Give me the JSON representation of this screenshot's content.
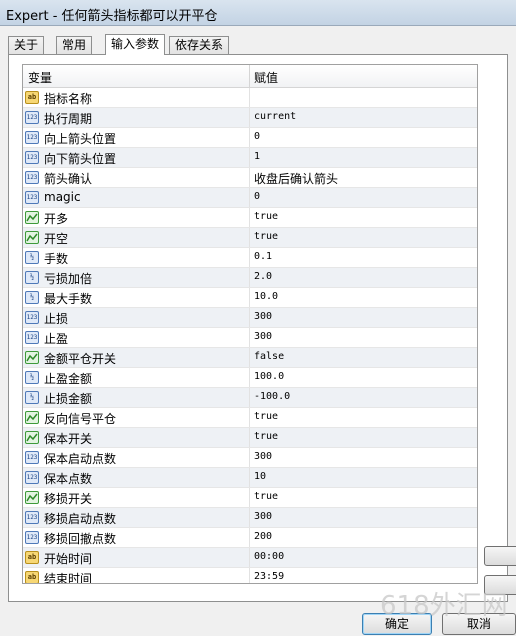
{
  "window": {
    "title": "Expert - 任何箭头指标都可以开平仓"
  },
  "tabs": [
    {
      "label": "关于",
      "active": false
    },
    {
      "label": "常用",
      "active": false
    },
    {
      "label": "输入参数",
      "active": true
    },
    {
      "label": "依存关系",
      "active": false
    }
  ],
  "grid": {
    "header": {
      "variable": "变量",
      "value": "赋值"
    },
    "rows": [
      {
        "icon": "ab-string-icon",
        "name": "指标名称",
        "value": ""
      },
      {
        "icon": "123-integer-icon",
        "name": "执行周期",
        "value": "current"
      },
      {
        "icon": "123-integer-icon",
        "name": "向上箭头位置",
        "value": "0"
      },
      {
        "icon": "123-integer-icon",
        "name": "向下箭头位置",
        "value": "1"
      },
      {
        "icon": "123-integer-icon",
        "name": "箭头确认",
        "value": "收盘后确认箭头"
      },
      {
        "icon": "123-integer-icon",
        "name": "magic",
        "value": "0"
      },
      {
        "icon": "bool-chart-icon",
        "name": "开多",
        "value": "true"
      },
      {
        "icon": "bool-chart-icon",
        "name": "开空",
        "value": "true"
      },
      {
        "icon": "double-icon",
        "name": "手数",
        "value": "0.1"
      },
      {
        "icon": "double-icon",
        "name": "亏损加倍",
        "value": "2.0"
      },
      {
        "icon": "double-icon",
        "name": "最大手数",
        "value": "10.0"
      },
      {
        "icon": "123-integer-icon",
        "name": "止损",
        "value": "300"
      },
      {
        "icon": "123-integer-icon",
        "name": "止盈",
        "value": "300"
      },
      {
        "icon": "bool-chart-icon",
        "name": "金额平仓开关",
        "value": "false"
      },
      {
        "icon": "double-icon",
        "name": "止盈金额",
        "value": "100.0"
      },
      {
        "icon": "double-icon",
        "name": "止损金额",
        "value": "-100.0"
      },
      {
        "icon": "bool-chart-icon",
        "name": "反向信号平仓",
        "value": "true"
      },
      {
        "icon": "bool-chart-icon",
        "name": "保本开关",
        "value": "true"
      },
      {
        "icon": "123-integer-icon",
        "name": "保本启动点数",
        "value": "300"
      },
      {
        "icon": "123-integer-icon",
        "name": "保本点数",
        "value": "10"
      },
      {
        "icon": "bool-chart-icon",
        "name": "移损开关",
        "value": "true"
      },
      {
        "icon": "123-integer-icon",
        "name": "移损启动点数",
        "value": "300"
      },
      {
        "icon": "123-integer-icon",
        "name": "移损回撤点数",
        "value": "200"
      },
      {
        "icon": "ab-string-icon",
        "name": "开始时间",
        "value": "00:00"
      },
      {
        "icon": "ab-string-icon",
        "name": "结束时间",
        "value": "23:59"
      }
    ]
  },
  "buttons": {
    "ok": "确定",
    "cancel": "取消"
  },
  "watermark": "618外汇网"
}
